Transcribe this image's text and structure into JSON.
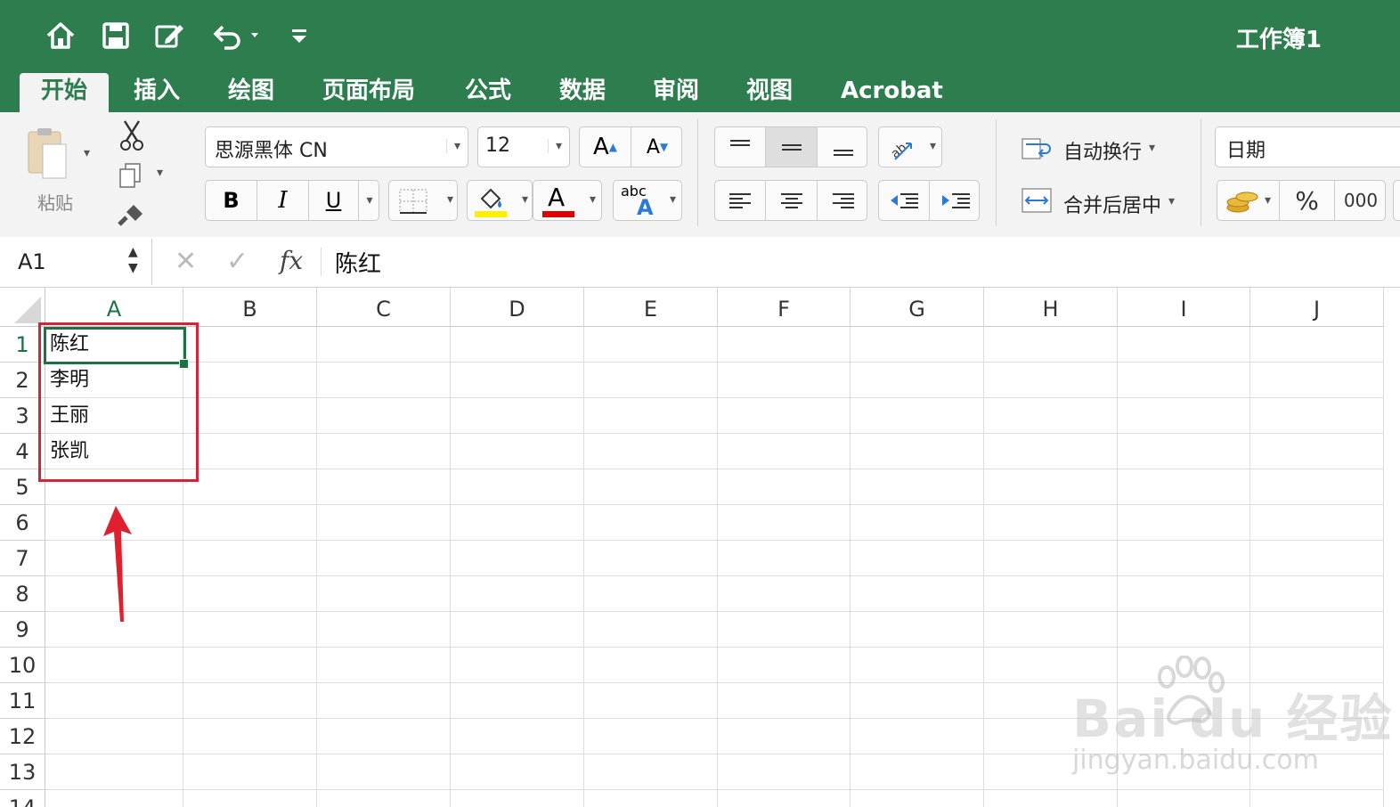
{
  "window": {
    "title": "工作簿1",
    "accent": "#2e7d4f"
  },
  "qat": {
    "icons": [
      "home-icon",
      "save-icon",
      "edit-icon",
      "undo-icon",
      "customize-icon"
    ]
  },
  "tabs": [
    {
      "label": "开始",
      "active": true
    },
    {
      "label": "插入"
    },
    {
      "label": "绘图"
    },
    {
      "label": "页面布局"
    },
    {
      "label": "公式"
    },
    {
      "label": "数据"
    },
    {
      "label": "审阅"
    },
    {
      "label": "视图"
    },
    {
      "label": "Acrobat"
    }
  ],
  "ribbon": {
    "paste_label": "粘贴",
    "font_name": "思源黑体 CN",
    "font_size": "12",
    "bold": "B",
    "italic": "I",
    "underline": "U",
    "font_color_glyph": "A",
    "abc": "abc",
    "wrap_text": "自动换行",
    "merge_center": "合并后居中",
    "number_format": "日期",
    "percent": "%",
    "thousands": "000"
  },
  "formula_bar": {
    "name_box": "A1",
    "fx": "fx",
    "content": "陈红"
  },
  "sheet": {
    "columns": [
      "A",
      "B",
      "C",
      "D",
      "E",
      "F",
      "G",
      "H",
      "I",
      "J"
    ],
    "rows": [
      "1",
      "2",
      "3",
      "4",
      "5",
      "6",
      "7",
      "8",
      "9",
      "10",
      "11",
      "12",
      "13",
      "14"
    ],
    "cells": {
      "A1": "陈红",
      "A2": "李明",
      "A3": "王丽",
      "A4": "张凯"
    },
    "selected": "A1",
    "highlight_color": "#d0253b"
  },
  "watermark": {
    "brand": "Bai du 经验",
    "url": "jingyan.baidu.com"
  }
}
